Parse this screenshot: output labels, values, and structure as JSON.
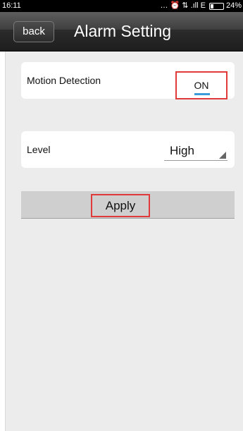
{
  "status_bar": {
    "time": "16:11",
    "icons_text": "… ⏰ ⇅ .ıll E",
    "battery_percent": "24%"
  },
  "header": {
    "back_label": "back",
    "title": "Alarm Setting"
  },
  "settings": {
    "motion_detection": {
      "label": "Motion Detection",
      "value": "ON"
    },
    "level": {
      "label": "Level",
      "value": "High"
    }
  },
  "actions": {
    "apply_label": "Apply"
  },
  "colors": {
    "highlight_red": "#e03a3a",
    "toggle_accent": "#3a9bd8",
    "title_bar_dark": "#2b2b2b",
    "content_bg": "#ececec"
  },
  "icons": [
    "back-button",
    "alarm-clock-icon",
    "data-transfer-icon",
    "signal-icon",
    "battery-icon",
    "dropdown-arrow-icon"
  ]
}
